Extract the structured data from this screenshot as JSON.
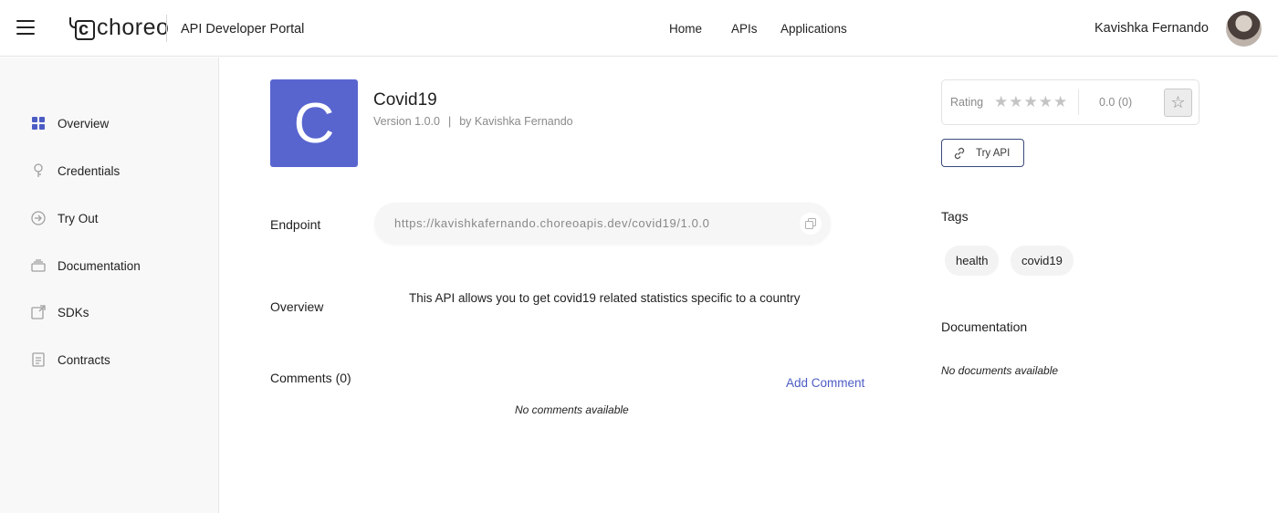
{
  "header": {
    "logo_text": "choreo",
    "portal_title": "API Developer Portal",
    "nav": [
      "Home",
      "APIs",
      "Applications"
    ],
    "user_name": "Kavishka Fernando"
  },
  "sidebar": {
    "items": [
      {
        "label": "Overview",
        "icon": "overview-grid-icon",
        "active": true
      },
      {
        "label": "Credentials",
        "icon": "key-icon"
      },
      {
        "label": "Try Out",
        "icon": "arrow-circle-icon"
      },
      {
        "label": "Documentation",
        "icon": "document-stack-icon"
      },
      {
        "label": "SDKs",
        "icon": "external-box-icon"
      },
      {
        "label": "Contracts",
        "icon": "checklist-icon"
      }
    ]
  },
  "api": {
    "logo_letter": "C",
    "name": "Covid19",
    "version": "Version 1.0.0",
    "separator": "|",
    "author": "by Kavishka Fernando",
    "endpoint_label": "Endpoint",
    "endpoint_url": "https://kavishkafernando.choreoapis.dev/covid19/1.0.0",
    "overview_label": "Overview",
    "overview_text": "This API allows you to get covid19 related statistics specific to a country",
    "comments_label": "Comments (0)",
    "add_comment": "Add Comment",
    "no_comments": "No comments available"
  },
  "rating": {
    "label": "Rating",
    "stars": 0,
    "max_stars": 5,
    "score": "0.0 (0)"
  },
  "try_api_label": "Try API",
  "tags": {
    "title": "Tags",
    "items": [
      "health",
      "covid19"
    ]
  },
  "documentation": {
    "title": "Documentation",
    "empty": "No documents available"
  },
  "colors": {
    "accent": "#4b5cc4",
    "api_logo_bg": "#5865cf"
  }
}
